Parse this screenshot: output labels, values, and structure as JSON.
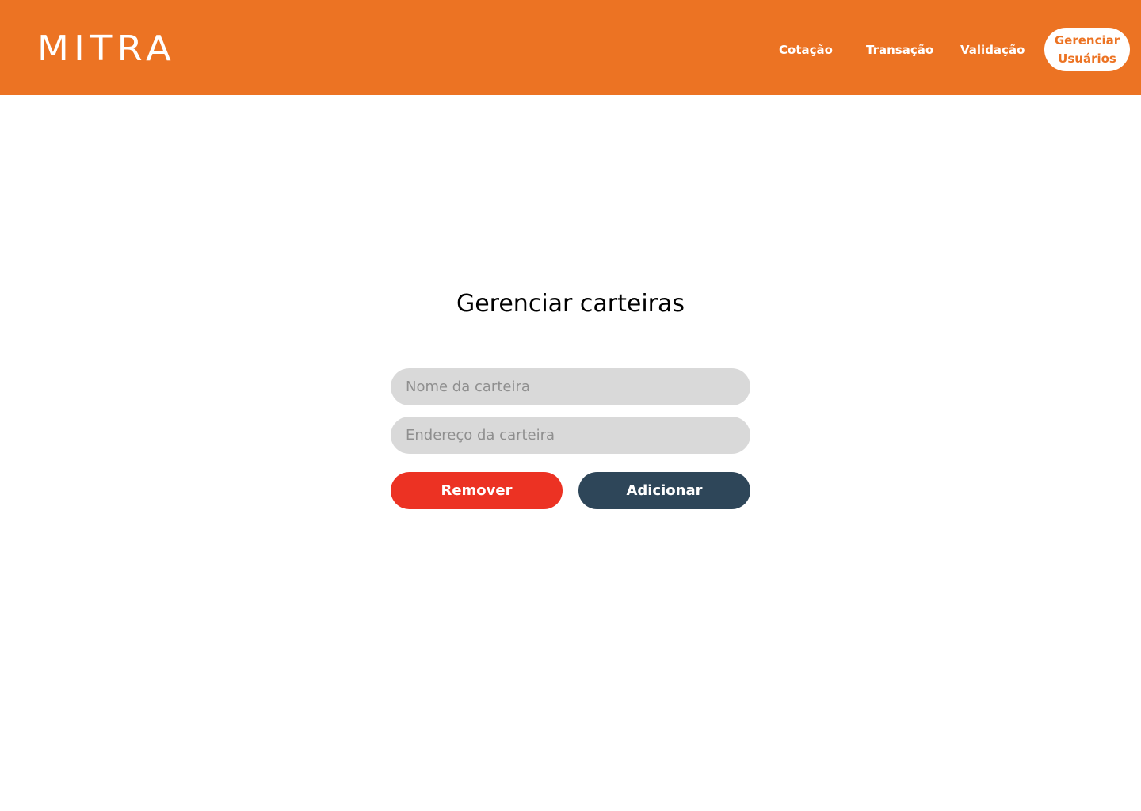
{
  "brand": {
    "logo_text": "MITRA",
    "primary_color": "#ec7323"
  },
  "nav": {
    "cotacao": "Cotação",
    "transacao": "Transação",
    "validacao": "Validação",
    "active_line1": "Gerenciar",
    "active_line2": "Usuários"
  },
  "main": {
    "title": "Gerenciar carteiras",
    "wallet_name_placeholder": "Nome da carteira",
    "wallet_address_placeholder": "Endereço da carteira",
    "remove_label": "Remover",
    "add_label": "Adicionar",
    "remove_color": "#ec3223",
    "add_color": "#2e4659"
  }
}
